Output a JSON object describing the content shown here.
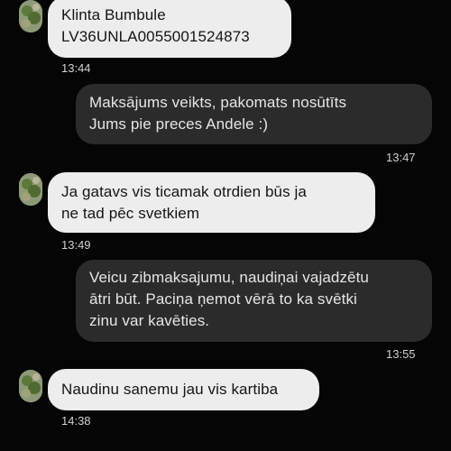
{
  "messages": [
    {
      "direction": "incoming",
      "lines": [
        "Klinta Bumbule",
        "LV36UNLA0055001524873"
      ],
      "time": "13:44"
    },
    {
      "direction": "outgoing",
      "lines": [
        "Maksājums veikts, pakomats nosūtīts",
        "Jums pie preces Andele :)"
      ],
      "time": "13:47"
    },
    {
      "direction": "incoming",
      "lines": [
        "Ja gatavs vis ticamak otrdien būs ja",
        "ne tad pēc svetkiem"
      ],
      "time": "13:49"
    },
    {
      "direction": "outgoing",
      "lines": [
        "Veicu zibmaksajumu, naudiņai vajadzētu",
        "ātri būt. Paciņa ņemot vērā to ka svētki",
        "zinu var kavēties."
      ],
      "time": "13:55"
    },
    {
      "direction": "incoming",
      "lines": [
        "Naudinu sanemu jau vis kartiba"
      ],
      "time": "14:38"
    }
  ],
  "colors": {
    "background": "#050505",
    "incoming_bubble": "#ededed",
    "outgoing_bubble": "#2b2b2b",
    "incoming_text": "#151515",
    "outgoing_text": "#e6e6e6",
    "timestamp": "#cfcfcf"
  },
  "icons": {
    "avatar": "contact-avatar-icon"
  }
}
